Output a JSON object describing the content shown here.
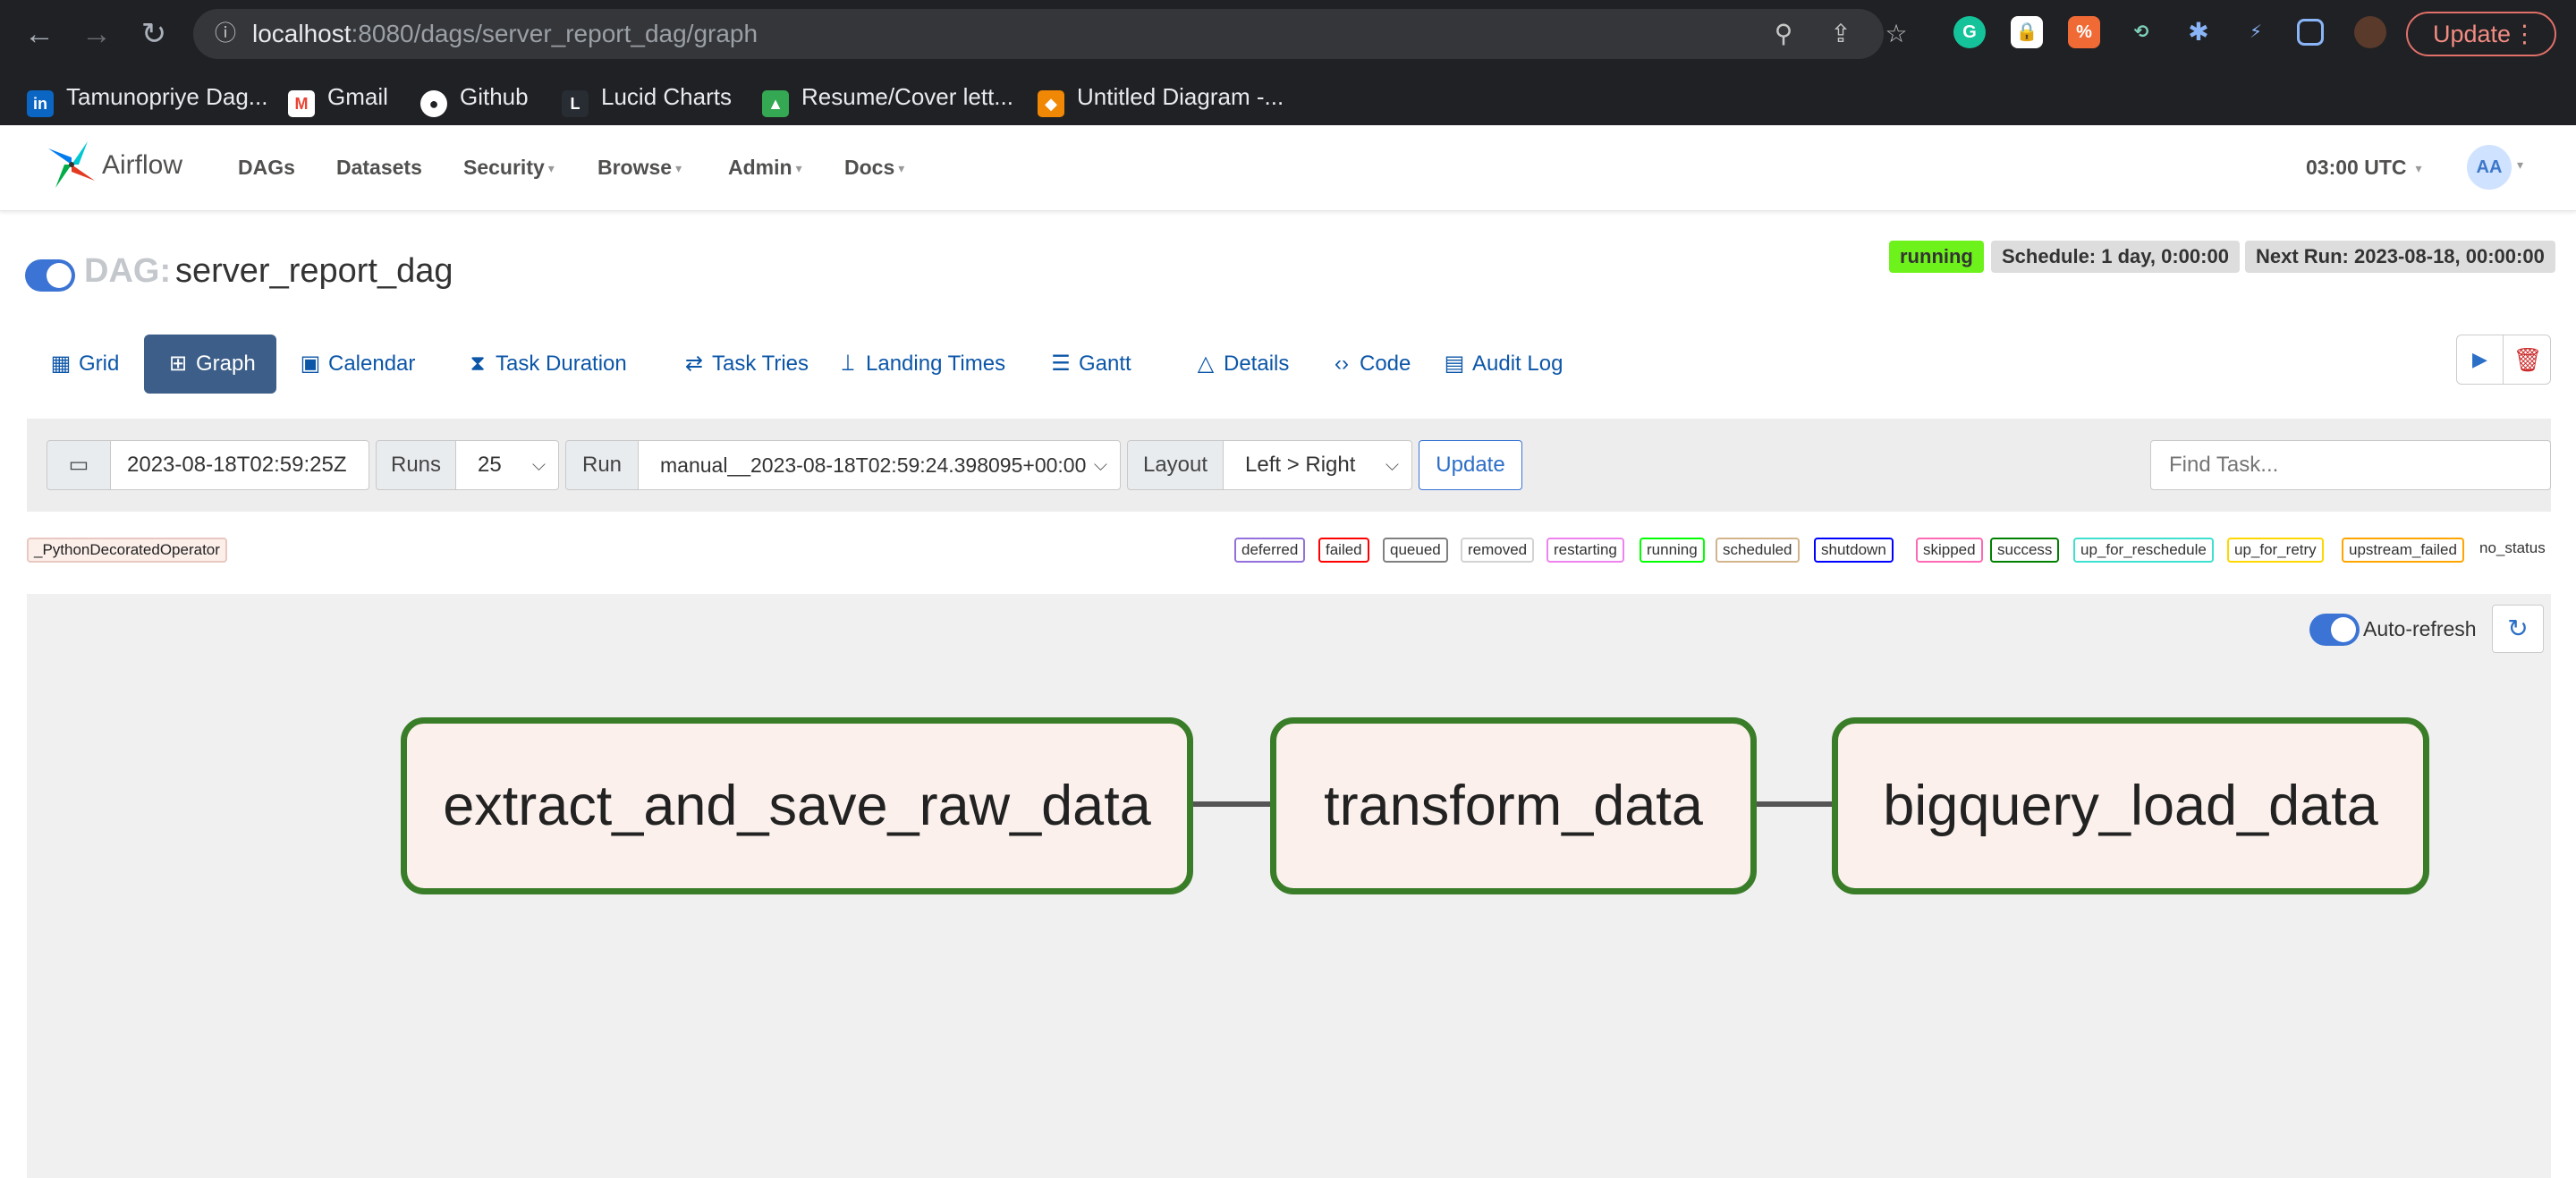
{
  "browser": {
    "url_host": "localhost",
    "url_rest": ":8080/dags/server_report_dag/graph",
    "update_label": "Update",
    "bookmarks": [
      "Tamunopriye Dag...",
      "Gmail",
      "Github",
      "Lucid Charts",
      "Resume/Cover lett...",
      "Untitled Diagram -..."
    ]
  },
  "nav": {
    "logo_text": "Airflow",
    "menu": [
      "DAGs",
      "Datasets",
      "Security",
      "Browse",
      "Admin",
      "Docs"
    ],
    "clock": "03:00 UTC",
    "avatar": "AA"
  },
  "dag": {
    "prefix": "DAG:",
    "name": "server_report_dag",
    "state": "running",
    "schedule": "Schedule: 1 day, 0:00:00",
    "next_run": "Next Run: 2023-08-18, 00:00:00"
  },
  "tabs": [
    "Grid",
    "Graph",
    "Calendar",
    "Task Duration",
    "Task Tries",
    "Landing Times",
    "Gantt",
    "Details",
    "Code",
    "Audit Log"
  ],
  "active_tab": "Graph",
  "filters": {
    "date": "2023-08-18T02:59:25Z",
    "runs_label": "Runs",
    "runs_value": "25",
    "run_label": "Run",
    "run_value": "manual__2023-08-18T02:59:24.398095+00:00",
    "layout_label": "Layout",
    "layout_value": "Left > Right",
    "update_btn": "Update",
    "find_placeholder": "Find Task..."
  },
  "operator_tag": "_PythonDecoratedOperator",
  "states": [
    {
      "label": "deferred",
      "color": "#9370db"
    },
    {
      "label": "failed",
      "color": "#ff0000"
    },
    {
      "label": "queued",
      "color": "#808080"
    },
    {
      "label": "removed",
      "color": "#d3d3d3"
    },
    {
      "label": "restarting",
      "color": "#ee82ee"
    },
    {
      "label": "running",
      "color": "#00ff00"
    },
    {
      "label": "scheduled",
      "color": "#d2b48c"
    },
    {
      "label": "shutdown",
      "color": "#0000ff"
    },
    {
      "label": "skipped",
      "color": "#ff69b4"
    },
    {
      "label": "success",
      "color": "#008000"
    },
    {
      "label": "up_for_reschedule",
      "color": "#40e0d0"
    },
    {
      "label": "up_for_retry",
      "color": "#ffd700"
    },
    {
      "label": "upstream_failed",
      "color": "#ffa500"
    }
  ],
  "no_status": "no_status",
  "graph": {
    "auto_refresh": "Auto-refresh",
    "tasks": [
      "extract_and_save_raw_data",
      "transform_data",
      "bigquery_load_data"
    ],
    "task_state": "success",
    "task_border": "#3a7d28",
    "task_fill": "#fbf0eb"
  },
  "colors": {
    "accent": "#3b74d4",
    "active_tab": "#3c5e88",
    "running_badge": "#6ef21c",
    "chrome_bg": "#202124"
  }
}
